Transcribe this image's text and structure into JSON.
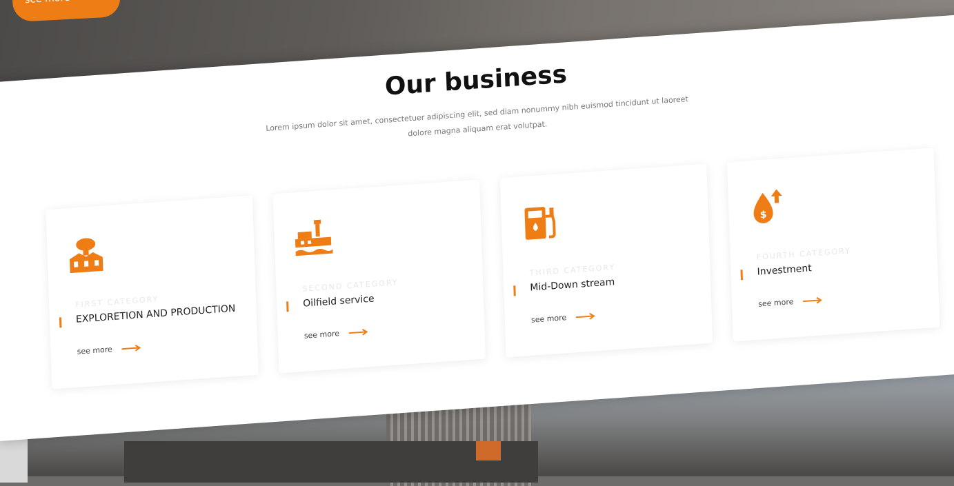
{
  "hero": {
    "button_label": "see more"
  },
  "section": {
    "title": "Our business",
    "description": "Lorem ipsum dolor sit amet, consectetuer adipiscing elit, sed diam nonummy nibh euismod tincidunt ut laoreet dolore magna aliquam erat volutpat."
  },
  "cards": [
    {
      "category": "FIRST CATEGORY",
      "name": "EXPLORETION AND PRODUCTION",
      "link": "see more",
      "icon": "oil-exploration-icon"
    },
    {
      "category": "SECOND CATEGORY",
      "name": "Oilfield service",
      "link": "see more",
      "icon": "oil-rig-ship-icon"
    },
    {
      "category": "THIRD CATEGORY",
      "name": "Mid-Down stream",
      "link": "see more",
      "icon": "fuel-pump-icon"
    },
    {
      "category": "FOURTH CATEGORY",
      "name": "Investment",
      "link": "see more",
      "icon": "oil-price-icon"
    }
  ],
  "colors": {
    "accent": "#ee7d15",
    "text": "#222222",
    "muted": "#777777"
  }
}
